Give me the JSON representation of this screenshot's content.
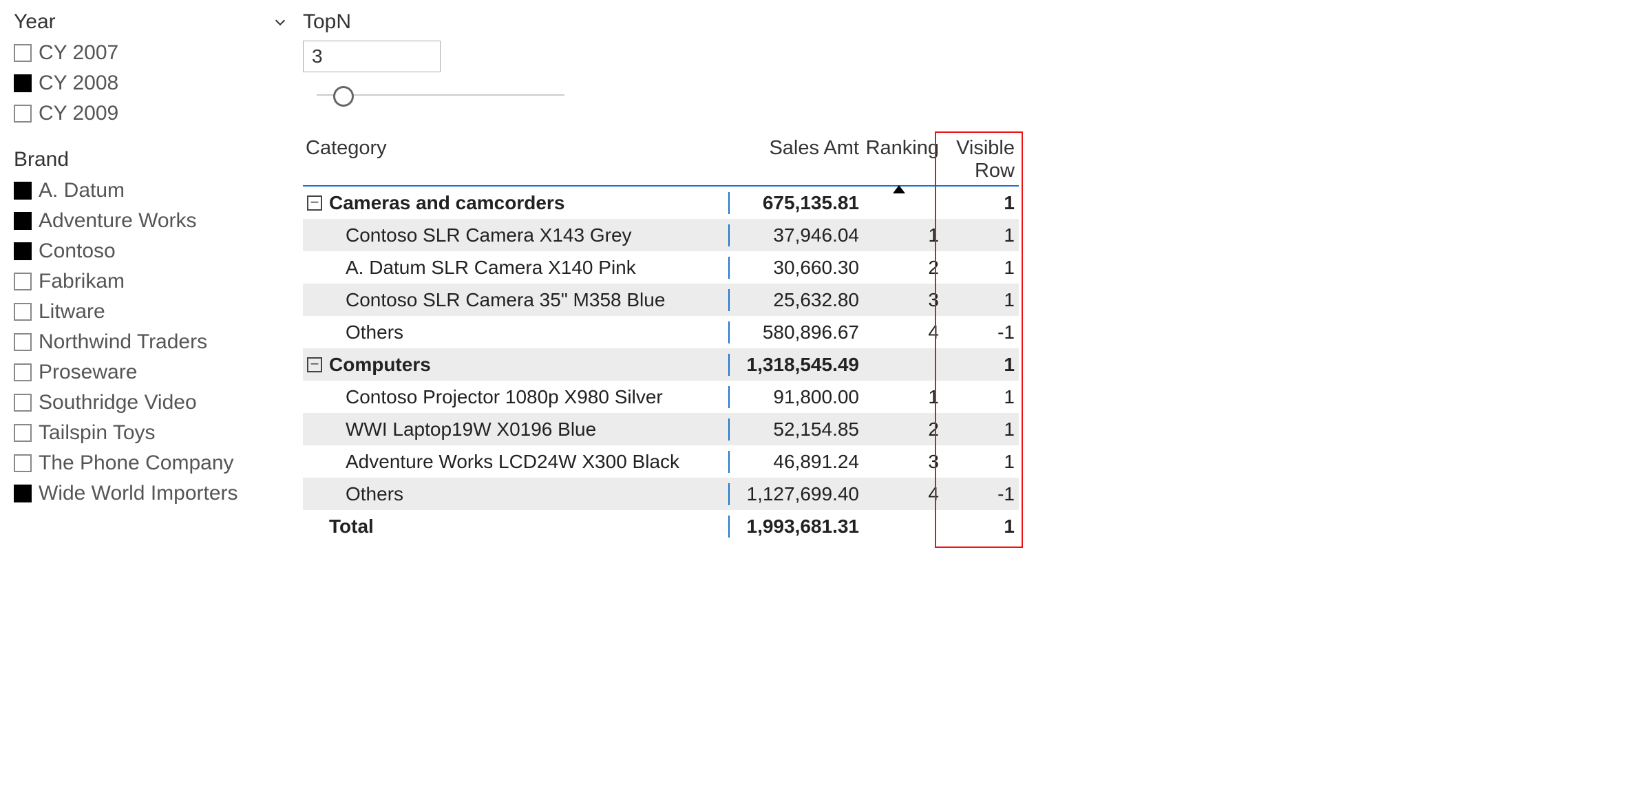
{
  "year_slicer": {
    "title": "Year",
    "items": [
      {
        "label": "CY 2007",
        "checked": false
      },
      {
        "label": "CY 2008",
        "checked": true
      },
      {
        "label": "CY 2009",
        "checked": false
      }
    ]
  },
  "brand_slicer": {
    "title": "Brand",
    "items": [
      {
        "label": "A. Datum",
        "checked": true
      },
      {
        "label": "Adventure Works",
        "checked": true
      },
      {
        "label": "Contoso",
        "checked": true
      },
      {
        "label": "Fabrikam",
        "checked": false
      },
      {
        "label": "Litware",
        "checked": false
      },
      {
        "label": "Northwind Traders",
        "checked": false
      },
      {
        "label": "Proseware",
        "checked": false
      },
      {
        "label": "Southridge Video",
        "checked": false
      },
      {
        "label": "Tailspin Toys",
        "checked": false
      },
      {
        "label": "The Phone Company",
        "checked": false
      },
      {
        "label": "Wide World Importers",
        "checked": true
      }
    ]
  },
  "topn": {
    "label": "TopN",
    "value": "3"
  },
  "matrix": {
    "headers": {
      "category": "Category",
      "sales": "Sales Amt",
      "ranking": "Ranking",
      "visible": "Visible Row"
    },
    "rows": [
      {
        "type": "group",
        "label": "Cameras and camcorders",
        "sales": "675,135.81",
        "ranking": "",
        "visible": "1",
        "alt": false
      },
      {
        "type": "child",
        "label": "Contoso SLR Camera X143 Grey",
        "sales": "37,946.04",
        "ranking": "1",
        "visible": "1",
        "alt": true
      },
      {
        "type": "child",
        "label": "A. Datum SLR Camera X140 Pink",
        "sales": "30,660.30",
        "ranking": "2",
        "visible": "1",
        "alt": false
      },
      {
        "type": "child",
        "label": "Contoso SLR Camera 35\" M358 Blue",
        "sales": "25,632.80",
        "ranking": "3",
        "visible": "1",
        "alt": true
      },
      {
        "type": "child",
        "label": "Others",
        "sales": "580,896.67",
        "ranking": "4",
        "visible": "-1",
        "alt": false
      },
      {
        "type": "group",
        "label": "Computers",
        "sales": "1,318,545.49",
        "ranking": "",
        "visible": "1",
        "alt": true
      },
      {
        "type": "child",
        "label": "Contoso Projector 1080p X980 Silver",
        "sales": "91,800.00",
        "ranking": "1",
        "visible": "1",
        "alt": false
      },
      {
        "type": "child",
        "label": "WWI Laptop19W X0196 Blue",
        "sales": "52,154.85",
        "ranking": "2",
        "visible": "1",
        "alt": true
      },
      {
        "type": "child",
        "label": "Adventure Works LCD24W X300 Black",
        "sales": "46,891.24",
        "ranking": "3",
        "visible": "1",
        "alt": false
      },
      {
        "type": "child",
        "label": "Others",
        "sales": "1,127,699.40",
        "ranking": "4",
        "visible": "-1",
        "alt": true
      }
    ],
    "total": {
      "label": "Total",
      "sales": "1,993,681.31",
      "ranking": "",
      "visible": "1"
    }
  }
}
